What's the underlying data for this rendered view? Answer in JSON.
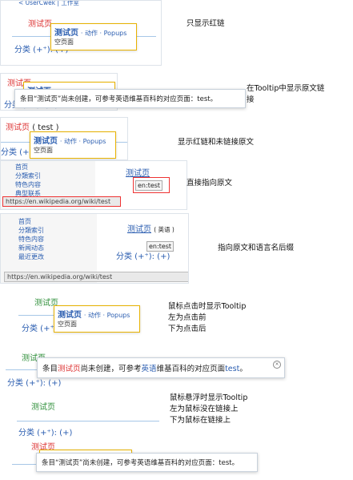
{
  "common": {
    "page_title": "测试页",
    "actions_label": "· 动作 · Popups",
    "empty_page": "空页面",
    "category_label": "分类 (+⁺): (+)",
    "tooltip_text": "条目“测试页”尚未创建，可参考英语维基百科的对应页面：test。",
    "ext_link": "en:test",
    "en_url": "https://en.wikipedia.org/wiki/test"
  },
  "sections": [
    {
      "id": "s1",
      "top_text": "< UserCwek | 工作室",
      "annotation": "只显示红链"
    },
    {
      "id": "s2",
      "annotation": "在Tooltip中显示原文链接"
    },
    {
      "id": "s3",
      "paren": "( test )",
      "annotation": "显示红链和未链接原文"
    },
    {
      "id": "s4",
      "annotation": "直接指向原文",
      "sidebar": [
        "首页",
        "分類索引",
        "特色内容",
        "典型联系"
      ]
    },
    {
      "id": "s5",
      "lang": "( 英语 )",
      "annotation": "指向原文和语言名后缀",
      "sidebar": [
        "首页",
        "分類索引",
        "特色内容",
        "新闻动态",
        "最近更改"
      ]
    },
    {
      "id": "s6",
      "annotation": "鼠标点击时显示Tooltip\n左为点击前\n下为点击后"
    },
    {
      "id": "s7",
      "tooltip_parts": [
        "条目",
        "测试页",
        "尚未创建，可参考",
        "英语",
        "维基百科的对应页面",
        "test",
        "。"
      ]
    },
    {
      "id": "s8",
      "annotation": "鼠标悬浮时显示Tooltip\n左为鼠标没在链接上\n下为鼠标在链接上"
    },
    {
      "id": "s9"
    }
  ]
}
